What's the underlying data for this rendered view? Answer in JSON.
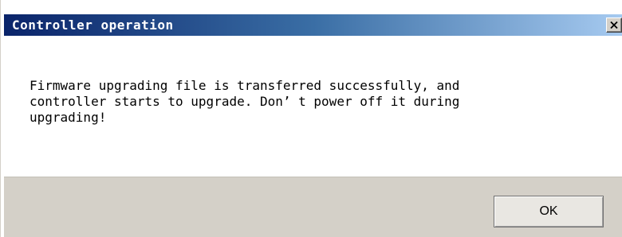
{
  "dialog": {
    "title": "Controller operation",
    "close_icon": "close-x-icon",
    "message": "Firmware upgrading file is transferred successfully, and\ncontroller starts to upgrade. Don’ t power off it during\nupgrading!",
    "ok_label": "OK"
  },
  "colors": {
    "title_start": "#0a246a",
    "title_end": "#a6caf0",
    "button_bar": "#d4d0c8",
    "title_text": "#ffffff"
  }
}
